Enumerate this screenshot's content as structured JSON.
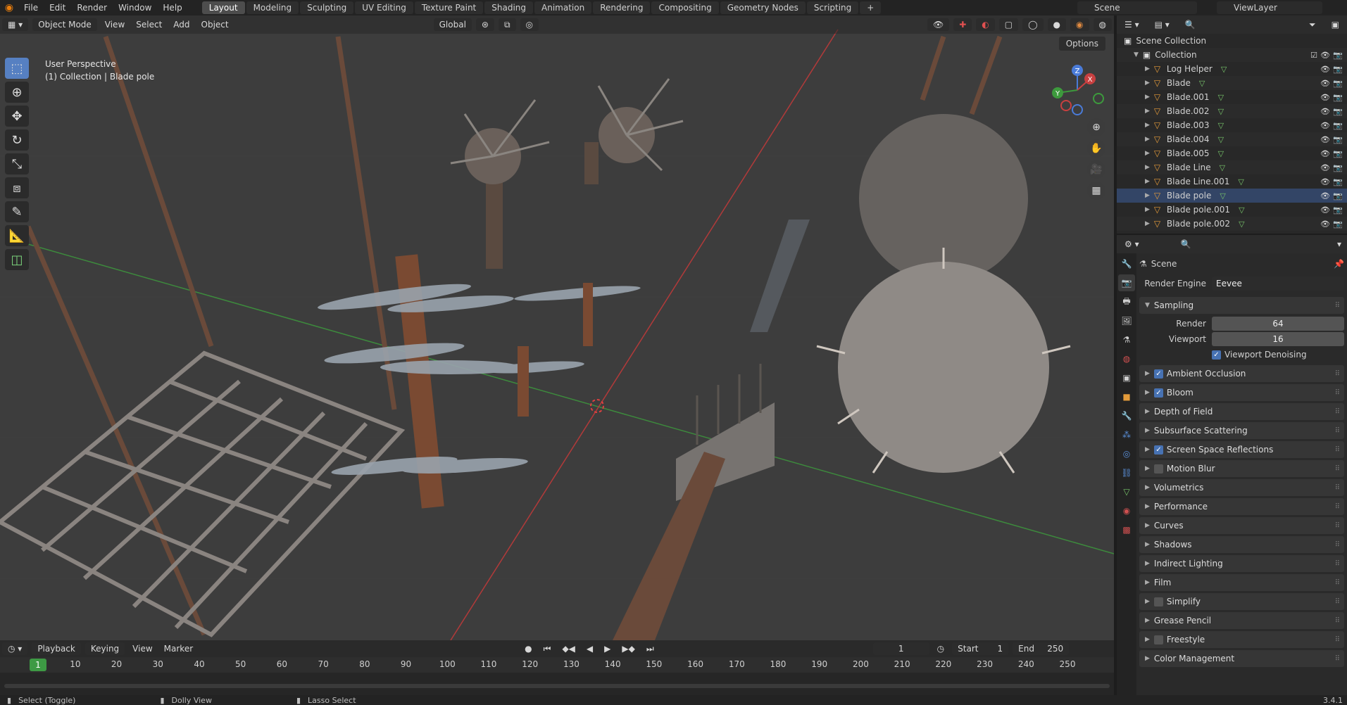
{
  "topbar": {
    "menus": [
      "File",
      "Edit",
      "Render",
      "Window",
      "Help"
    ],
    "workspaces": [
      "Layout",
      "Modeling",
      "Sculpting",
      "UV Editing",
      "Texture Paint",
      "Shading",
      "Animation",
      "Rendering",
      "Compositing",
      "Geometry Nodes",
      "Scripting"
    ],
    "active_workspace": "Layout",
    "add_tab": "+",
    "scene": "Scene",
    "view_layer": "ViewLayer"
  },
  "viewport": {
    "mode": "Object Mode",
    "menus": [
      "View",
      "Select",
      "Add",
      "Object"
    ],
    "orientation": "Global",
    "options_label": "Options",
    "info_line1": "User Perspective",
    "info_line2": "(1) Collection | Blade pole",
    "gizmo": {
      "x": "X",
      "y": "Y",
      "z": "Z"
    }
  },
  "timeline": {
    "menus": [
      "Playback",
      "Keying",
      "View",
      "Marker"
    ],
    "current_frame": "1",
    "start_label": "Start",
    "start": "1",
    "end_label": "End",
    "end": "250",
    "ticks": [
      "1",
      "10",
      "20",
      "30",
      "40",
      "50",
      "60",
      "70",
      "80",
      "90",
      "100",
      "110",
      "120",
      "130",
      "140",
      "150",
      "160",
      "170",
      "180",
      "190",
      "200",
      "210",
      "220",
      "230",
      "240",
      "250"
    ]
  },
  "statusbar": {
    "hint1": "Select (Toggle)",
    "hint2": "Dolly View",
    "hint3": "Lasso Select",
    "version": "3.4.1"
  },
  "outliner": {
    "scene_collection": "Scene Collection",
    "collection": "Collection",
    "items": [
      "Log Helper",
      "Blade",
      "Blade.001",
      "Blade.002",
      "Blade.003",
      "Blade.004",
      "Blade.005",
      "Blade Line",
      "Blade Line.001",
      "Blade pole",
      "Blade pole.001",
      "Blade pole.002"
    ],
    "selected": "Blade pole"
  },
  "properties": {
    "context": "Scene",
    "render_engine_label": "Render Engine",
    "render_engine": "Eevee",
    "sampling": {
      "title": "Sampling",
      "render_label": "Render",
      "render": "64",
      "viewport_label": "Viewport",
      "viewport": "16",
      "denoise_label": "Viewport Denoising",
      "denoise": true
    },
    "panels": [
      {
        "label": "Ambient Occlusion",
        "checkbox": true,
        "checked": true
      },
      {
        "label": "Bloom",
        "checkbox": true,
        "checked": true
      },
      {
        "label": "Depth of Field",
        "checkbox": false
      },
      {
        "label": "Subsurface Scattering",
        "checkbox": false
      },
      {
        "label": "Screen Space Reflections",
        "checkbox": true,
        "checked": true
      },
      {
        "label": "Motion Blur",
        "checkbox": true,
        "checked": false
      },
      {
        "label": "Volumetrics",
        "checkbox": false
      },
      {
        "label": "Performance",
        "checkbox": false
      },
      {
        "label": "Curves",
        "checkbox": false
      },
      {
        "label": "Shadows",
        "checkbox": false
      },
      {
        "label": "Indirect Lighting",
        "checkbox": false
      },
      {
        "label": "Film",
        "checkbox": false
      },
      {
        "label": "Simplify",
        "checkbox": true,
        "checked": false
      },
      {
        "label": "Grease Pencil",
        "checkbox": false
      },
      {
        "label": "Freestyle",
        "checkbox": true,
        "checked": false
      },
      {
        "label": "Color Management",
        "checkbox": false
      }
    ]
  },
  "colors": {
    "accent": "#4772b3",
    "object_orange": "#e49b3a",
    "mesh_green": "#77c46a",
    "axis_red": "#b23a3a",
    "axis_green": "#3d8a3d",
    "frame_green": "#3d9a44"
  }
}
